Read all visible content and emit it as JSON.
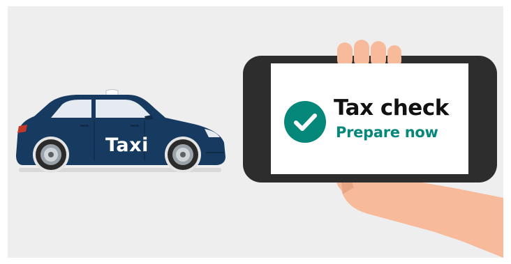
{
  "taxi": {
    "label": "Taxi",
    "body_color": "#173b60"
  },
  "phone": {
    "title": "Tax check",
    "subtitle": "Prepare now",
    "badge_color": "#05887a",
    "icon": "check-icon"
  },
  "colors": {
    "background": "#eeeeee",
    "skin": "#f7bb9b",
    "phone_frame": "#2d2d2d",
    "title_text": "#111111",
    "subtitle_text": "#05887a"
  }
}
